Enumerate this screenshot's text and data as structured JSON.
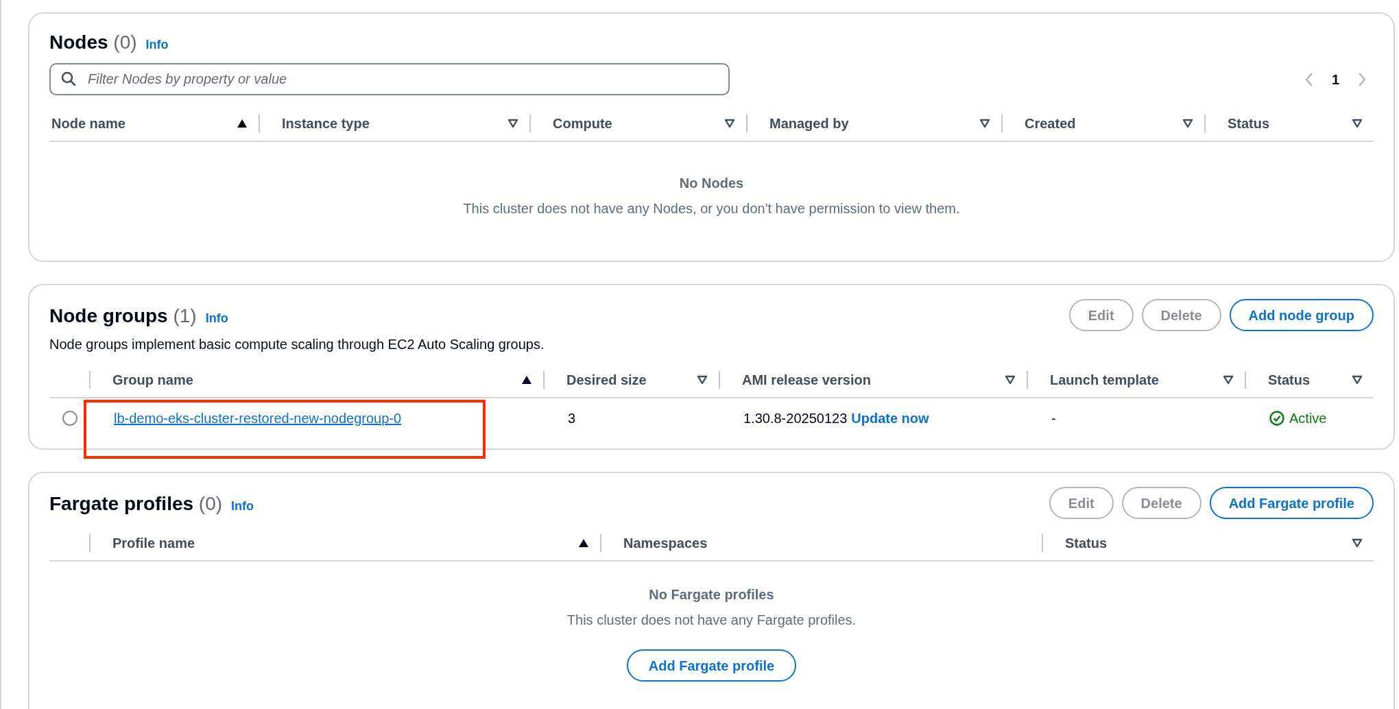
{
  "nodes": {
    "title": "Nodes",
    "count": "(0)",
    "info": "Info",
    "search": {
      "placeholder": "Filter Nodes by property or value"
    },
    "pagination": {
      "page": "1",
      "prev_disabled": true,
      "next_disabled": true
    },
    "columns": [
      {
        "label": "Node name",
        "sorted": true
      },
      {
        "label": "Instance type",
        "sorted": false
      },
      {
        "label": "Compute",
        "sorted": false
      },
      {
        "label": "Managed by",
        "sorted": false
      },
      {
        "label": "Created",
        "sorted": false
      },
      {
        "label": "Status",
        "sorted": false
      }
    ],
    "empty": {
      "title": "No Nodes",
      "message": "This cluster does not have any Nodes, or you don't have permission to view them."
    }
  },
  "node_groups": {
    "title": "Node groups",
    "count": "(1)",
    "info": "Info",
    "description": "Node groups implement basic compute scaling through EC2 Auto Scaling groups.",
    "buttons": [
      {
        "label": "Edit",
        "kind": "normal",
        "disabled": true
      },
      {
        "label": "Delete",
        "kind": "normal",
        "disabled": true
      },
      {
        "label": "Add node group",
        "kind": "primary",
        "disabled": false
      }
    ],
    "columns": [
      {
        "label": "Group name",
        "sorted": true
      },
      {
        "label": "Desired size",
        "sorted": false
      },
      {
        "label": "AMI release version",
        "sorted": false
      },
      {
        "label": "Launch template",
        "sorted": false
      },
      {
        "label": "Status",
        "sorted": false
      }
    ],
    "rows": [
      {
        "selected": false,
        "highlighted": true,
        "group_name": "lb-demo-eks-cluster-restored-new-nodegroup-0",
        "desired_size": "3",
        "ami_release_version": "1.30.8-20250123",
        "ami_action": "Update now",
        "launch_template": "-",
        "status": "Active"
      }
    ]
  },
  "fargate_profiles": {
    "title": "Fargate profiles",
    "count": "(0)",
    "info": "Info",
    "buttons": [
      {
        "label": "Edit",
        "kind": "normal",
        "disabled": true
      },
      {
        "label": "Delete",
        "kind": "normal",
        "disabled": true
      },
      {
        "label": "Add Fargate profile",
        "kind": "primary",
        "disabled": false
      }
    ],
    "columns": [
      {
        "label": "Profile name",
        "sorted": true
      },
      {
        "label": "Namespaces"
      },
      {
        "label": "Status",
        "sorted": false
      }
    ],
    "empty": {
      "title": "No Fargate profiles",
      "message": "This cluster does not have any Fargate profiles.",
      "button": "Add Fargate profile"
    }
  }
}
